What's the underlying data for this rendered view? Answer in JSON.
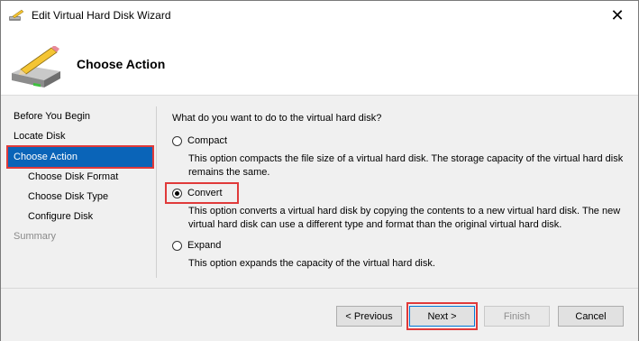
{
  "window": {
    "title": "Edit Virtual Hard Disk Wizard",
    "close_glyph": "✕"
  },
  "header": {
    "title": "Choose Action",
    "icon": "disk-pencil-icon"
  },
  "nav": {
    "items": [
      {
        "label": "Before You Begin",
        "state": "normal"
      },
      {
        "label": "Locate Disk",
        "state": "normal"
      },
      {
        "label": "Choose Action",
        "state": "active"
      },
      {
        "label": "Choose Disk Format",
        "state": "normal"
      },
      {
        "label": "Choose Disk Type",
        "state": "normal"
      },
      {
        "label": "Configure Disk",
        "state": "normal"
      },
      {
        "label": "Summary",
        "state": "disabled"
      }
    ]
  },
  "content": {
    "question": "What do you want to do to the virtual hard disk?",
    "options": [
      {
        "label": "Compact",
        "checked": false,
        "description": "This option compacts the file size of a virtual hard disk. The storage capacity of the virtual hard disk remains the same."
      },
      {
        "label": "Convert",
        "checked": true,
        "description": "This option converts a virtual hard disk by copying the contents to a new virtual hard disk. The new virtual hard disk can use a different type and format than the original virtual hard disk."
      },
      {
        "label": "Expand",
        "checked": false,
        "description": "This option expands the capacity of the virtual hard disk."
      }
    ]
  },
  "footer": {
    "previous_label": "< Previous",
    "next_label": "Next >",
    "finish_label": "Finish",
    "cancel_label": "Cancel"
  },
  "colors": {
    "selection": "#0a64b8",
    "highlight_box": "#e03a3a"
  }
}
